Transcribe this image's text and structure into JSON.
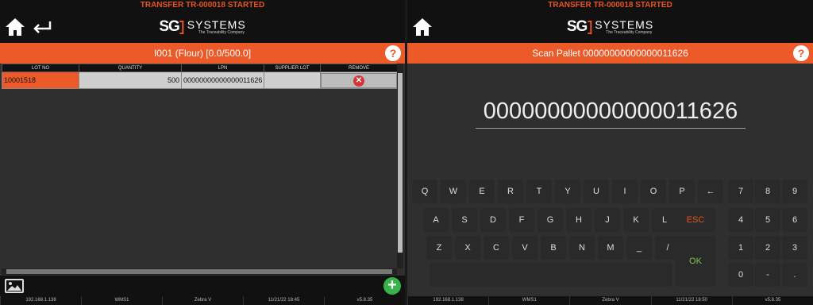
{
  "left": {
    "banner": "TRANSFER TR-000018 STARTED",
    "logo_sg": "SG",
    "logo_systems": "SYSTEMS",
    "logo_tagline": "The Traceability Company",
    "title": "I001 (Flour) [0.0/500.0]",
    "help": "?",
    "columns": [
      "LOT NO",
      "QUANTITY",
      "LPN",
      "SUPPLIER LOT",
      "REMOVE"
    ],
    "row": {
      "lot": "10001518",
      "quantity": "500",
      "lpn": "00000000000000011626",
      "supplier_lot": ""
    },
    "status": [
      "192.168.1.138",
      "WMS1",
      "Zebra V",
      "11/21/22 18:45",
      "v5.8.35"
    ]
  },
  "right": {
    "banner": "TRANSFER TR-000018 STARTED",
    "logo_sg": "SG",
    "logo_systems": "SYSTEMS",
    "logo_tagline": "The Traceability Company",
    "title": "Scan Pallet 00000000000000011626",
    "help": "?",
    "scan_value": "00000000000000011626",
    "keys_row1": [
      "Q",
      "W",
      "E",
      "R",
      "T",
      "Y",
      "U",
      "I",
      "O",
      "P"
    ],
    "backspace": "←",
    "keys_row2": [
      "A",
      "S",
      "D",
      "F",
      "G",
      "H",
      "J",
      "K",
      "L"
    ],
    "esc": "ESC",
    "keys_row3": [
      "Z",
      "X",
      "C",
      "V",
      "B",
      "N",
      "M",
      "_",
      "/"
    ],
    "ok": "OK",
    "numpad": [
      "7",
      "8",
      "9",
      "4",
      "5",
      "6",
      "1",
      "2",
      "3",
      "0",
      "-",
      "."
    ],
    "status": [
      "192.168.1.138",
      "WMS1",
      "Zebra V",
      "11/21/22 18:50",
      "v5.8.35"
    ]
  }
}
